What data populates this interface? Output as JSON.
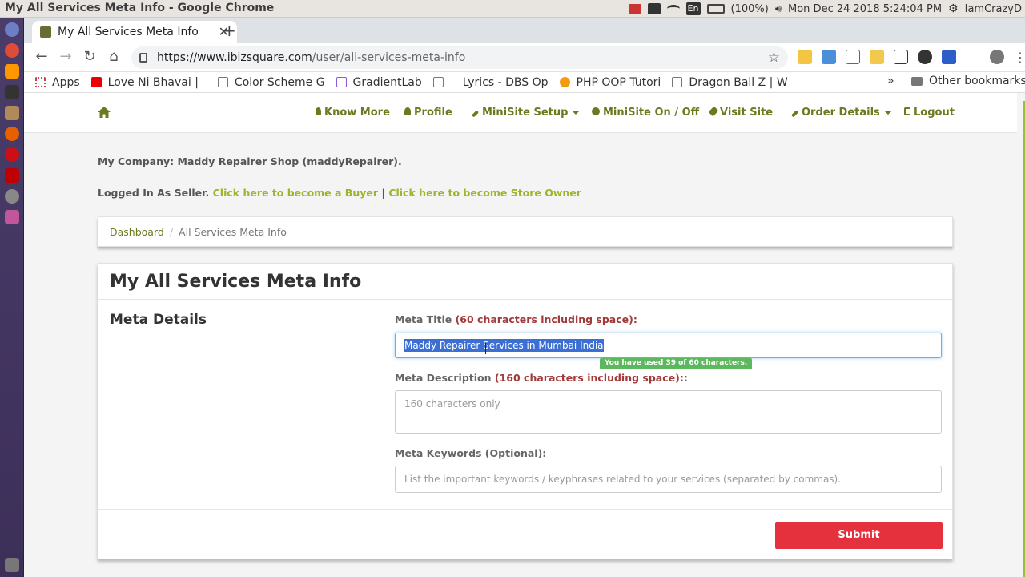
{
  "os": {
    "window_title": "My All Services Meta Info - Google Chrome",
    "lang": "En",
    "battery": "(100%)",
    "clock": "Mon Dec 24 2018  5:24:04 PM",
    "user": "IamCrazyD"
  },
  "browser": {
    "tab_title": "My All Services Meta Info",
    "tab_close": "✕",
    "new_tab": "+",
    "url_host": "https://www.ibizsquare.com",
    "url_path": "/user/all-services-meta-info",
    "back": "←",
    "forward": "→",
    "reload": "↻",
    "home": "⌂",
    "star": "☆",
    "menu": "⋮",
    "bookmarks": [
      {
        "label": "Apps"
      },
      {
        "label": "Love Ni Bhavai |"
      },
      {
        "label": "Color Scheme G"
      },
      {
        "label": "GradientLab"
      },
      {
        "label": "Lyrics - DBS Op"
      },
      {
        "label": "PHP OOP Tutori"
      },
      {
        "label": "Dragon Ball Z | W"
      }
    ],
    "bookmarks_more": "»",
    "other_bookmarks": "Other bookmarks"
  },
  "nav": {
    "items": [
      {
        "label": "Know More"
      },
      {
        "label": "Profile"
      },
      {
        "label": "MiniSite Setup"
      },
      {
        "label": "MiniSite On / Off"
      },
      {
        "label": "Visit Site"
      },
      {
        "label": "Order Details"
      },
      {
        "label": "Logout"
      }
    ]
  },
  "company": {
    "text": "My Company: Maddy Repairer Shop (maddyRepairer)."
  },
  "login": {
    "prefix": "Logged In As Seller.",
    "buyer_link": "Click here to become a Buyer",
    "separator": "|",
    "owner_link": "Click here to become Store Owner"
  },
  "breadcrumb": {
    "dashboard": "Dashboard",
    "separator": "/",
    "current": "All Services Meta Info"
  },
  "panel": {
    "title": "My All Services Meta Info",
    "section": "Meta Details",
    "meta_title_label": "Meta Title",
    "meta_title_hint": "(60 characters including space):",
    "meta_title_value": "Maddy Repairer Services in Mumbai India",
    "counter": "You have used 39 of 60 characters.",
    "meta_desc_label": "Meta Description",
    "meta_desc_hint": "(160 characters including space):",
    "meta_desc_suffix": ":",
    "meta_desc_placeholder": "160 characters only",
    "meta_kw_label": "Meta Keywords (Optional):",
    "meta_kw_placeholder": "List the important keywords / keyphrases related to your services (separated by commas).",
    "submit": "Submit"
  },
  "colors": {
    "nav_text": "#6b7a1e",
    "link": "#9ab62a",
    "hint": "#a33a3a",
    "submit": "#e5303e",
    "counter": "#5cb85c"
  }
}
